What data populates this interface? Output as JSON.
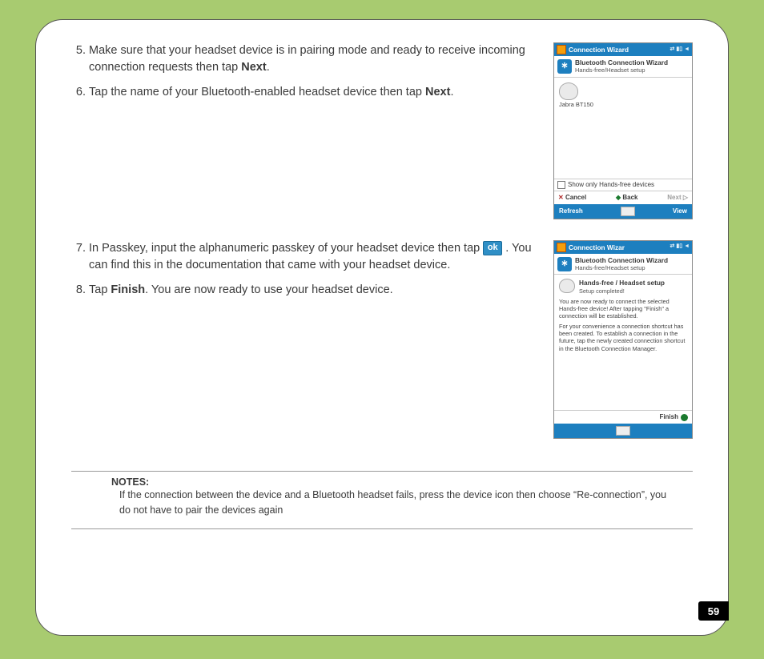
{
  "steps": {
    "s5": "Make sure that your headset device is in pairing mode and ready to receive incoming connection requests then tap ",
    "s5_bold": "Next",
    "s5_end": ".",
    "s6a": "Tap the name of your Bluetooth-enabled headset device then tap ",
    "s6_bold": "Next",
    "s6_end": ".",
    "s7a": "In Passkey, input the alphanumeric passkey of your headset device then tap ",
    "s7_ok": "ok",
    "s7b": ". You can find this in the documentation that came with your headset device.",
    "s8a": "Tap ",
    "s8_bold": "Finish",
    "s8b": ". You are now ready to use your headset device."
  },
  "phone1": {
    "title": "Connection Wizard",
    "hdr_title": "Bluetooth Connection Wizard",
    "hdr_sub": "Hands-free/Headset setup",
    "device": "Jabra BT150",
    "checkbox": "Show only Hands-free devices",
    "cancel": "Cancel",
    "back": "Back",
    "next": "Next",
    "soft_left": "Refresh",
    "soft_right": "View"
  },
  "phone2": {
    "title": "Connection Wizar",
    "hdr_title": "Bluetooth Connection Wizard",
    "hdr_sub": "Hands-free/Headset setup",
    "setup_title": "Hands-free / Headset setup",
    "setup_sub": "Setup completed!",
    "para1": "You are now ready to connect the selected Hands-free device! After tapping \"Finish\" a connection will be established.",
    "para2": "For your convenience a connection shortcut has been created. To establish a connection in the future, tap the newly created connection shortcut in the Bluetooth Connection Manager.",
    "finish": "Finish"
  },
  "notes": {
    "title": "NOTES:",
    "body": "If the connection between the device and a Bluetooth headset fails, press the device icon then choose “Re-connection”, you do not have to pair the devices again"
  },
  "page_number": "59"
}
